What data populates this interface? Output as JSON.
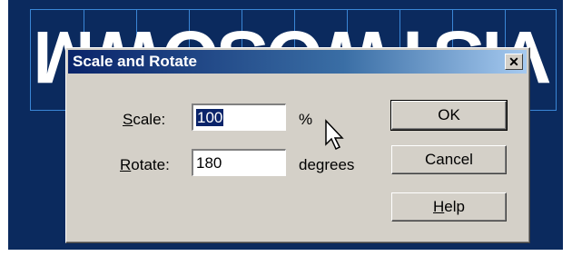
{
  "background_banner": {
    "mirrored_text": "VISTWOSOWM"
  },
  "dialog": {
    "title": "Scale and Rotate",
    "close_glyph": "✕",
    "scale": {
      "label_prefix": "",
      "label_accel": "S",
      "label_rest": "cale:",
      "value": "100",
      "unit": "%"
    },
    "rotate": {
      "label_accel": "R",
      "label_rest": "otate:",
      "value": "180",
      "unit": "degrees"
    },
    "buttons": {
      "ok": "OK",
      "cancel": "Cancel",
      "help_accel": "H",
      "help_rest": "elp"
    }
  },
  "colors": {
    "canvas": "#0b2a5e",
    "title_gradient_start": "#0a246a",
    "dialog_face": "#d4d0c8",
    "selection": "#0a246a"
  },
  "icons": {
    "cursor": "arrow-cursor-icon",
    "close": "close-icon"
  }
}
